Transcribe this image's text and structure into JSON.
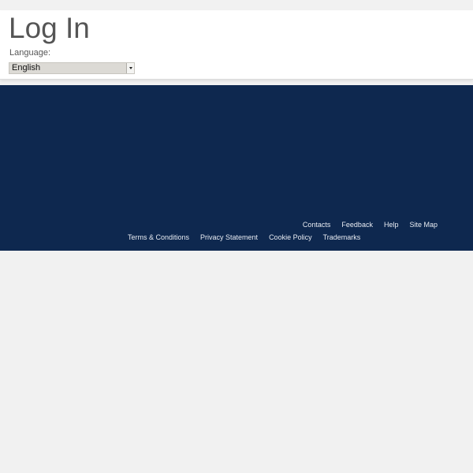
{
  "header": {
    "title": "Log In",
    "language_label": "Language:",
    "language_selected": "English"
  },
  "footer": {
    "row1": [
      "Contacts",
      "Feedback",
      "Help",
      "Site Map"
    ],
    "row2": [
      "Terms & Conditions",
      "Privacy Statement",
      "Cookie Policy",
      "Trademarks"
    ]
  }
}
